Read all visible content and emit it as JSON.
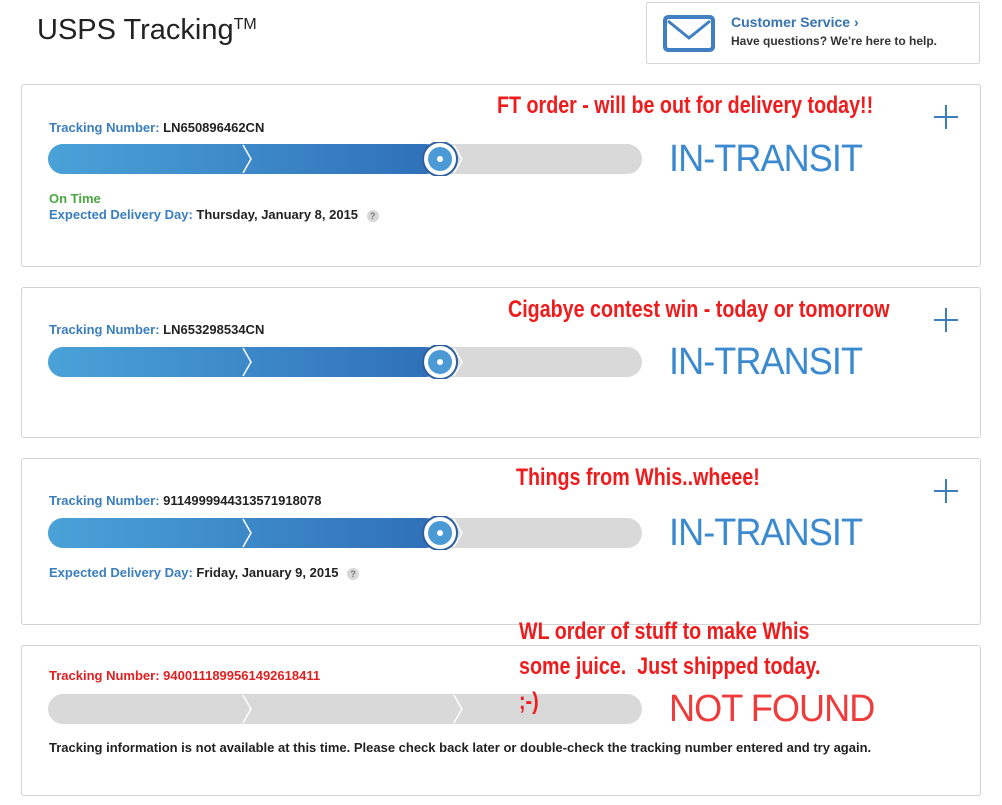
{
  "header": {
    "title": "USPS Tracking",
    "title_mark": "TM",
    "customer_service": {
      "link_label": "Customer Service ›",
      "subtitle": "Have questions? We're here to help."
    }
  },
  "colors": {
    "accent_blue": "#3b7ebd",
    "progress_blue": "#3b8ad0",
    "ontime_green": "#4aa640",
    "error_red": "#ee3b3b",
    "annotation_red": "#ee1c1c"
  },
  "packages": [
    {
      "tracking_label": "Tracking Number:",
      "tracking_number": "LN650896462CN",
      "status_note": "On Time",
      "delivery_label": "Expected Delivery Day:",
      "delivery_date": "Thursday, January 8, 2015",
      "status": "IN-TRANSIT",
      "progress_fraction": 0.66,
      "annotation": "FT order - will be out for delivery today!!"
    },
    {
      "tracking_label": "Tracking Number:",
      "tracking_number": "LN653298534CN",
      "status": "IN-TRANSIT",
      "progress_fraction": 0.66,
      "annotation": "Cigabye contest win - today or tomorrow"
    },
    {
      "tracking_label": "Tracking Number:",
      "tracking_number": "9114999944313571918078",
      "delivery_label": "Expected Delivery Day:",
      "delivery_date": "Friday, January 9, 2015",
      "status": "IN-TRANSIT",
      "progress_fraction": 0.66,
      "annotation": "Things from Whis..wheee!"
    },
    {
      "tracking_label": "Tracking Number:",
      "tracking_number": "9400111899561492618411",
      "status": "NOT FOUND",
      "progress_fraction": 0,
      "info": "Tracking information is not available at this time. Please check back later or double-check the tracking number entered and try again.",
      "annotation": "WL order of stuff to make Whis\nsome juice.  Just shipped today.\n;-)"
    }
  ]
}
